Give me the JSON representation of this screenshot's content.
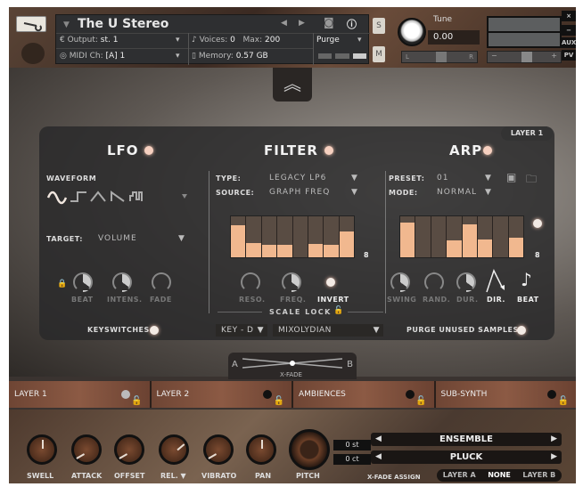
{
  "header": {
    "instrument_name": "The U Stereo",
    "output_label": "Output:",
    "output_value": "st. 1",
    "midi_label": "MIDI Ch:",
    "midi_value": "[A] 1",
    "voices_label": "Voices:",
    "voices_value": "0",
    "max_label": "Max:",
    "max_value": "200",
    "memory_label": "Memory:",
    "memory_value": "0.57 GB",
    "purge_label": "Purge",
    "solo_label": "S",
    "mute_label": "M",
    "tune_label": "Tune",
    "tune_value": "0.00",
    "pan_left": "L",
    "pan_right": "R",
    "vol_minus": "−",
    "vol_plus": "+",
    "close_label": "×",
    "minimize_label": "−",
    "aux_label": "AUX",
    "pv_label": "PV"
  },
  "layer_badge": "LAYER 1",
  "lfo": {
    "title": "LFO",
    "waveform_label": "WAVEFORM",
    "waveforms": [
      "sine",
      "square",
      "triangle",
      "saw",
      "random"
    ],
    "selected_waveform": "sine",
    "target_label": "TARGET:",
    "target_value": "VOLUME",
    "knobs": [
      {
        "label": "BEAT",
        "value": 0.35
      },
      {
        "label": "INTENS.",
        "value": 0.4
      },
      {
        "label": "FADE",
        "value": 0.0
      }
    ],
    "keyswitches_label": "KEYSWITCHES:"
  },
  "filter": {
    "title": "FILTER",
    "type_label": "TYPE:",
    "type_value": "LEGACY LP6",
    "source_label": "SOURCE:",
    "source_value": "GRAPH FREQ",
    "steps": [
      0.78,
      0.35,
      0.3,
      0.3,
      0.0,
      0.33,
      0.3,
      0.62
    ],
    "step_count": "8",
    "knobs": [
      {
        "label": "RESO.",
        "value": 0.0
      },
      {
        "label": "FREQ.",
        "value": 0.5
      }
    ],
    "invert_label": "INVERT",
    "scale_lock_label": "SCALE LOCK",
    "key_value": "KEY - D",
    "mode_value": "MIXOLYDIAN"
  },
  "arp": {
    "title": "ARP",
    "preset_label": "PRESET:",
    "preset_value": "01",
    "mode_label": "MODE:",
    "mode_value": "NORMAL",
    "steps": [
      0.85,
      0.0,
      0.0,
      0.42,
      0.8,
      0.44,
      0.0,
      0.47
    ],
    "step_count": "8",
    "knobs": [
      {
        "label": "SWING",
        "value": 0.4
      },
      {
        "label": "RAND.",
        "value": 0.0
      },
      {
        "label": "DUR.",
        "value": 0.3
      }
    ],
    "dir_label": "DIR.",
    "beat_label": "BEAT",
    "purge_label": "PURGE UNUSED SAMPLES:"
  },
  "xfade": {
    "label": "X-FADE",
    "a": "A",
    "b": "B"
  },
  "tabs": [
    "LAYER 1",
    "LAYER 2",
    "AMBIENCES",
    "SUB-SYNTH"
  ],
  "footer": {
    "knobs": [
      "SWELL",
      "ATTACK",
      "OFFSET",
      "REL. ▼",
      "VIBRATO",
      "PAN"
    ],
    "pitch_label": "PITCH",
    "semitone_value": "0 st",
    "cent_value": "0 ct",
    "preset1": "ENSEMBLE",
    "preset2": "PLUCK",
    "xfade_assign_label": "X-FADE ASSIGN",
    "xfade_options": [
      "LAYER A",
      "NONE",
      "LAYER B"
    ],
    "xfade_selected": "NONE"
  }
}
